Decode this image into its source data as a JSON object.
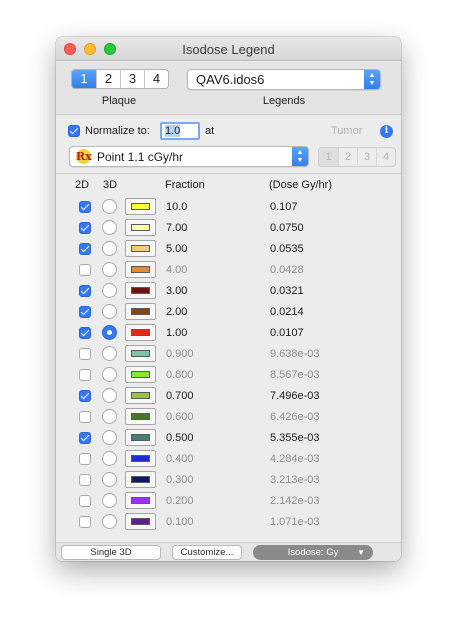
{
  "window": {
    "title": "Isodose Legend"
  },
  "plaque": {
    "segments": [
      "1",
      "2",
      "3",
      "4"
    ],
    "selected": 0,
    "label": "Plaque"
  },
  "legends": {
    "value": "QAV6.idos6",
    "label": "Legends"
  },
  "normalize": {
    "label": "Normalize to:",
    "checked": true,
    "value": "1.0",
    "suffix": "at",
    "tumor_label": "Tumor",
    "info_icon": "i"
  },
  "point": {
    "icon": "Rx",
    "value": "Point 1.1 cGy/hr"
  },
  "tumor_segments": [
    "1",
    "2",
    "3",
    "4"
  ],
  "columns": {
    "twod": "2D",
    "threed": "3D",
    "fraction": "Fraction",
    "dose": "(Dose Gy/hr)"
  },
  "rows": [
    {
      "checked": true,
      "radio": false,
      "color": "#ffff3c",
      "fraction": "10.0",
      "dose": "0.107"
    },
    {
      "checked": true,
      "radio": false,
      "color": "#ffffa8",
      "fraction": "7.00",
      "dose": "0.0750"
    },
    {
      "checked": true,
      "radio": false,
      "color": "#f2cc7c",
      "fraction": "5.00",
      "dose": "0.0535"
    },
    {
      "checked": false,
      "radio": false,
      "color": "#e8892c",
      "fraction": "4.00",
      "dose": "0.0428"
    },
    {
      "checked": true,
      "radio": false,
      "color": "#6e160e",
      "fraction": "3.00",
      "dose": "0.0321"
    },
    {
      "checked": true,
      "radio": false,
      "color": "#7e4a12",
      "fraction": "2.00",
      "dose": "0.0214"
    },
    {
      "checked": true,
      "radio": true,
      "color": "#e22a16",
      "fraction": "1.00",
      "dose": "0.0107"
    },
    {
      "checked": false,
      "radio": false,
      "color": "#7bc6a2",
      "fraction": "0.900",
      "dose": "9.638e-03"
    },
    {
      "checked": false,
      "radio": false,
      "color": "#86e834",
      "fraction": "0.800",
      "dose": "8.567e-03"
    },
    {
      "checked": true,
      "radio": false,
      "color": "#9ac23a",
      "fraction": "0.700",
      "dose": "7.496e-03"
    },
    {
      "checked": false,
      "radio": false,
      "color": "#3f7a22",
      "fraction": "0.600",
      "dose": "6.426e-03"
    },
    {
      "checked": true,
      "radio": false,
      "color": "#4a7d76",
      "fraction": "0.500",
      "dose": "5.355e-03"
    },
    {
      "checked": false,
      "radio": false,
      "color": "#1d2ad8",
      "fraction": "0.400",
      "dose": "4.284e-03"
    },
    {
      "checked": false,
      "radio": false,
      "color": "#0c1672",
      "fraction": "0.300",
      "dose": "3.213e-03"
    },
    {
      "checked": false,
      "radio": false,
      "color": "#9a34f0",
      "fraction": "0.200",
      "dose": "2.142e-03"
    },
    {
      "checked": false,
      "radio": false,
      "color": "#5a2290",
      "fraction": "0.100",
      "dose": "1.071e-03"
    }
  ],
  "bottom": {
    "single3d": "Single 3D",
    "customize": "Customize...",
    "isodose": "Isodose: Gy"
  }
}
